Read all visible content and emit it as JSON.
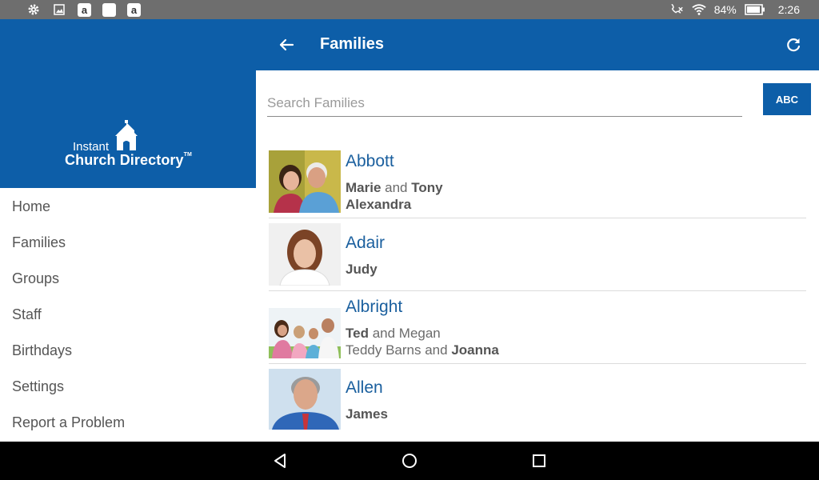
{
  "status_bar": {
    "battery": "84%",
    "time": "2:26",
    "notification_icons": [
      "gear-icon",
      "image-icon",
      "amazon-icon",
      "app-icon",
      "amazon-icon"
    ]
  },
  "sidebar": {
    "logo_line1": "Instant",
    "logo_line2": "Church Directory",
    "logo_tm": "TM",
    "items": [
      {
        "label": "Home"
      },
      {
        "label": "Families"
      },
      {
        "label": "Groups"
      },
      {
        "label": "Staff"
      },
      {
        "label": "Birthdays"
      },
      {
        "label": "Settings"
      },
      {
        "label": "Report a Problem"
      }
    ]
  },
  "appbar": {
    "title": "Families"
  },
  "search": {
    "placeholder": "Search Families",
    "value": ""
  },
  "abc_label": "ABC",
  "families": [
    {
      "name": "Abbott",
      "line1": [
        {
          "t": "Marie",
          "b": true
        },
        {
          "t": " and ",
          "b": false
        },
        {
          "t": "Tony",
          "b": true
        }
      ],
      "line2": [
        {
          "t": "Alexandra",
          "b": true
        }
      ]
    },
    {
      "name": "Adair",
      "line1": [
        {
          "t": "Judy",
          "b": true
        }
      ],
      "line2": []
    },
    {
      "name": "Albright",
      "line1": [
        {
          "t": "Ted",
          "b": true
        },
        {
          "t": " and Megan",
          "b": false
        }
      ],
      "line2": [
        {
          "t": "Teddy Barns and ",
          "b": false
        },
        {
          "t": "Joanna",
          "b": true
        }
      ]
    },
    {
      "name": "Allen",
      "line1": [
        {
          "t": "James",
          "b": true
        }
      ],
      "line2": []
    }
  ],
  "colors": {
    "brand_blue": "#0d5ea8",
    "name_blue": "#1a5f9e"
  }
}
